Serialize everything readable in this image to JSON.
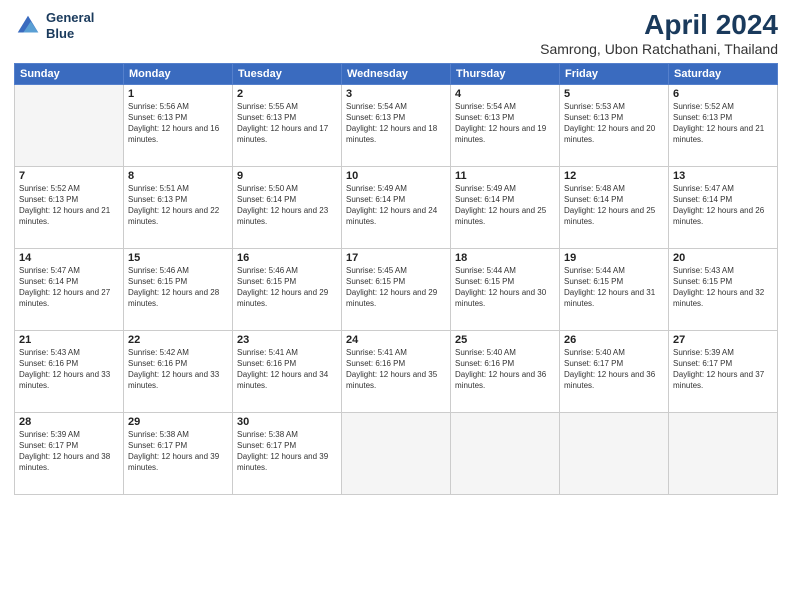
{
  "logo": {
    "line1": "General",
    "line2": "Blue"
  },
  "header": {
    "month": "April 2024",
    "location": "Samrong, Ubon Ratchathani, Thailand"
  },
  "weekdays": [
    "Sunday",
    "Monday",
    "Tuesday",
    "Wednesday",
    "Thursday",
    "Friday",
    "Saturday"
  ],
  "weeks": [
    [
      {
        "day": "",
        "empty": true
      },
      {
        "day": "1",
        "sunrise": "Sunrise: 5:56 AM",
        "sunset": "Sunset: 6:13 PM",
        "daylight": "Daylight: 12 hours and 16 minutes."
      },
      {
        "day": "2",
        "sunrise": "Sunrise: 5:55 AM",
        "sunset": "Sunset: 6:13 PM",
        "daylight": "Daylight: 12 hours and 17 minutes."
      },
      {
        "day": "3",
        "sunrise": "Sunrise: 5:54 AM",
        "sunset": "Sunset: 6:13 PM",
        "daylight": "Daylight: 12 hours and 18 minutes."
      },
      {
        "day": "4",
        "sunrise": "Sunrise: 5:54 AM",
        "sunset": "Sunset: 6:13 PM",
        "daylight": "Daylight: 12 hours and 19 minutes."
      },
      {
        "day": "5",
        "sunrise": "Sunrise: 5:53 AM",
        "sunset": "Sunset: 6:13 PM",
        "daylight": "Daylight: 12 hours and 20 minutes."
      },
      {
        "day": "6",
        "sunrise": "Sunrise: 5:52 AM",
        "sunset": "Sunset: 6:13 PM",
        "daylight": "Daylight: 12 hours and 21 minutes."
      }
    ],
    [
      {
        "day": "7",
        "sunrise": "Sunrise: 5:52 AM",
        "sunset": "Sunset: 6:13 PM",
        "daylight": "Daylight: 12 hours and 21 minutes."
      },
      {
        "day": "8",
        "sunrise": "Sunrise: 5:51 AM",
        "sunset": "Sunset: 6:13 PM",
        "daylight": "Daylight: 12 hours and 22 minutes."
      },
      {
        "day": "9",
        "sunrise": "Sunrise: 5:50 AM",
        "sunset": "Sunset: 6:14 PM",
        "daylight": "Daylight: 12 hours and 23 minutes."
      },
      {
        "day": "10",
        "sunrise": "Sunrise: 5:49 AM",
        "sunset": "Sunset: 6:14 PM",
        "daylight": "Daylight: 12 hours and 24 minutes."
      },
      {
        "day": "11",
        "sunrise": "Sunrise: 5:49 AM",
        "sunset": "Sunset: 6:14 PM",
        "daylight": "Daylight: 12 hours and 25 minutes."
      },
      {
        "day": "12",
        "sunrise": "Sunrise: 5:48 AM",
        "sunset": "Sunset: 6:14 PM",
        "daylight": "Daylight: 12 hours and 25 minutes."
      },
      {
        "day": "13",
        "sunrise": "Sunrise: 5:47 AM",
        "sunset": "Sunset: 6:14 PM",
        "daylight": "Daylight: 12 hours and 26 minutes."
      }
    ],
    [
      {
        "day": "14",
        "sunrise": "Sunrise: 5:47 AM",
        "sunset": "Sunset: 6:14 PM",
        "daylight": "Daylight: 12 hours and 27 minutes."
      },
      {
        "day": "15",
        "sunrise": "Sunrise: 5:46 AM",
        "sunset": "Sunset: 6:15 PM",
        "daylight": "Daylight: 12 hours and 28 minutes."
      },
      {
        "day": "16",
        "sunrise": "Sunrise: 5:46 AM",
        "sunset": "Sunset: 6:15 PM",
        "daylight": "Daylight: 12 hours and 29 minutes."
      },
      {
        "day": "17",
        "sunrise": "Sunrise: 5:45 AM",
        "sunset": "Sunset: 6:15 PM",
        "daylight": "Daylight: 12 hours and 29 minutes."
      },
      {
        "day": "18",
        "sunrise": "Sunrise: 5:44 AM",
        "sunset": "Sunset: 6:15 PM",
        "daylight": "Daylight: 12 hours and 30 minutes."
      },
      {
        "day": "19",
        "sunrise": "Sunrise: 5:44 AM",
        "sunset": "Sunset: 6:15 PM",
        "daylight": "Daylight: 12 hours and 31 minutes."
      },
      {
        "day": "20",
        "sunrise": "Sunrise: 5:43 AM",
        "sunset": "Sunset: 6:15 PM",
        "daylight": "Daylight: 12 hours and 32 minutes."
      }
    ],
    [
      {
        "day": "21",
        "sunrise": "Sunrise: 5:43 AM",
        "sunset": "Sunset: 6:16 PM",
        "daylight": "Daylight: 12 hours and 33 minutes."
      },
      {
        "day": "22",
        "sunrise": "Sunrise: 5:42 AM",
        "sunset": "Sunset: 6:16 PM",
        "daylight": "Daylight: 12 hours and 33 minutes."
      },
      {
        "day": "23",
        "sunrise": "Sunrise: 5:41 AM",
        "sunset": "Sunset: 6:16 PM",
        "daylight": "Daylight: 12 hours and 34 minutes."
      },
      {
        "day": "24",
        "sunrise": "Sunrise: 5:41 AM",
        "sunset": "Sunset: 6:16 PM",
        "daylight": "Daylight: 12 hours and 35 minutes."
      },
      {
        "day": "25",
        "sunrise": "Sunrise: 5:40 AM",
        "sunset": "Sunset: 6:16 PM",
        "daylight": "Daylight: 12 hours and 36 minutes."
      },
      {
        "day": "26",
        "sunrise": "Sunrise: 5:40 AM",
        "sunset": "Sunset: 6:17 PM",
        "daylight": "Daylight: 12 hours and 36 minutes."
      },
      {
        "day": "27",
        "sunrise": "Sunrise: 5:39 AM",
        "sunset": "Sunset: 6:17 PM",
        "daylight": "Daylight: 12 hours and 37 minutes."
      }
    ],
    [
      {
        "day": "28",
        "sunrise": "Sunrise: 5:39 AM",
        "sunset": "Sunset: 6:17 PM",
        "daylight": "Daylight: 12 hours and 38 minutes."
      },
      {
        "day": "29",
        "sunrise": "Sunrise: 5:38 AM",
        "sunset": "Sunset: 6:17 PM",
        "daylight": "Daylight: 12 hours and 39 minutes."
      },
      {
        "day": "30",
        "sunrise": "Sunrise: 5:38 AM",
        "sunset": "Sunset: 6:17 PM",
        "daylight": "Daylight: 12 hours and 39 minutes."
      },
      {
        "day": "",
        "empty": true
      },
      {
        "day": "",
        "empty": true
      },
      {
        "day": "",
        "empty": true
      },
      {
        "day": "",
        "empty": true
      }
    ]
  ]
}
